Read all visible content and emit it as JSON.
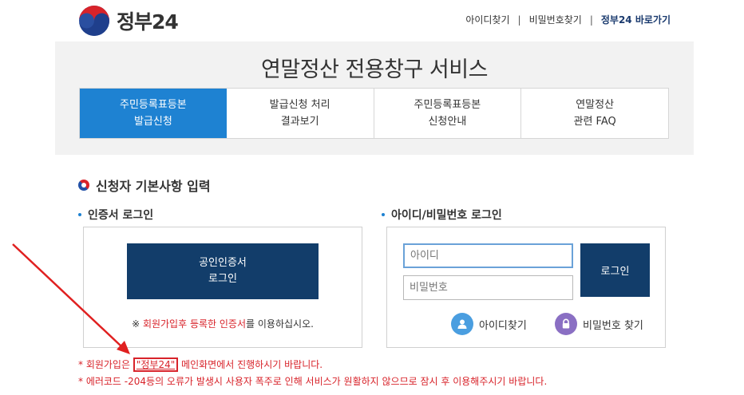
{
  "brand": {
    "name": "정부24"
  },
  "toplinks": {
    "find_id": "아이디찾기",
    "find_pw": "비밀번호찾기",
    "go_gov24": "정부24 바로가기"
  },
  "hero": {
    "title": "연말정산 전용창구 서비스",
    "tabs": [
      {
        "line1": "주민등록표등본",
        "line2": "발급신청"
      },
      {
        "line1": "발급신청 처리",
        "line2": "결과보기"
      },
      {
        "line1": "주민등록표등본",
        "line2": "신청안내"
      },
      {
        "line1": "연말정산",
        "line2": "관련 FAQ"
      }
    ]
  },
  "section": {
    "title": "신청자 기본사항 입력"
  },
  "cert": {
    "title": "인증서 로그인",
    "button_line1": "공인인증서",
    "button_line2": "로그인",
    "note_prefix": "※ ",
    "note_red": "회원가입후 등록한 인증서",
    "note_suffix": "를 이용하십시오."
  },
  "idlogin": {
    "title": "아이디/비밀번호 로그인",
    "id_placeholder": "아이디",
    "pw_placeholder": "비밀번호",
    "login_button": "로그인",
    "find_id": "아이디찾기",
    "find_pw": "비밀번호 찾기"
  },
  "notes": {
    "line1_prefix": "* 회원가입은 ",
    "line1_link": "\"정부24\"",
    "line1_suffix": " 메인화면에서 진행하시기 바랍니다.",
    "line2": "* 에러코드 -204등의 오류가 발생시 사용자 폭주로 인해 서비스가 원활하지 않으므로 잠시 후 이용해주시기 바랍니다."
  },
  "colors": {
    "navy": "#123d6a",
    "active_tab": "#1e82d2",
    "alert_red": "#d8232a"
  }
}
